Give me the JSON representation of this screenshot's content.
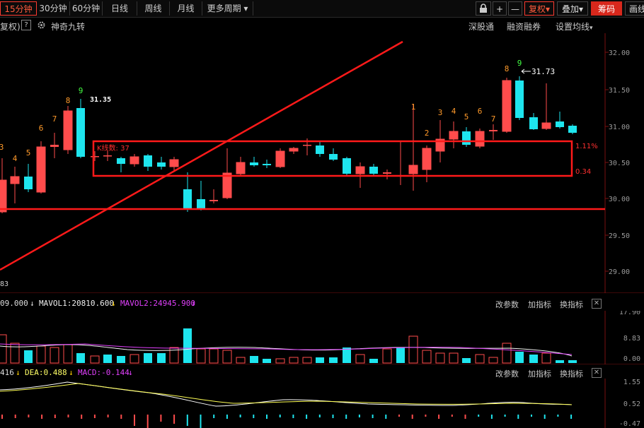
{
  "toolbar": {
    "tabs": [
      "15分钟",
      "30分钟",
      "60分钟",
      "日线",
      "周线",
      "月线",
      "更多周期"
    ],
    "active_tab": "15分钟",
    "more_arrow": "▾",
    "lock_icon": "lock-icon",
    "plus": "+",
    "minus": "—",
    "fuquan": "复权",
    "diejia": "叠加",
    "chouma": "筹码",
    "huaxian": "画线"
  },
  "subbar": {
    "fuquan": "复权)",
    "help": "?",
    "indicator": "神奇九转",
    "shengutong": "深股通",
    "rongzi": "融资融券",
    "settings": "设置均线"
  },
  "price_axis": [
    "32.00",
    "31.50",
    "31.00",
    "30.50",
    "30.00",
    "29.50",
    "29.00"
  ],
  "volume_axis": [
    "17.90",
    "8.83",
    "0.00"
  ],
  "macd_axis": [
    "1.55",
    "0.52",
    "-0.47"
  ],
  "annotations": {
    "high_left": "31.35",
    "high_right": "31.73",
    "box_count": "K线数: 37",
    "box_pct": "1.11%",
    "box_diff": "0.34",
    "bottom_left": "83"
  },
  "counts": {
    "left": [
      "3",
      "4",
      "5",
      "6",
      "7",
      "8",
      "9"
    ],
    "right": [
      "1",
      "2",
      "3",
      "4",
      "5",
      "6",
      "7",
      "8",
      "9"
    ]
  },
  "volume_row": {
    "vol": "09.000",
    "mavol1": "MAVOL1:20810.600",
    "mavol2": "MAVOL2:24945.900",
    "btn1": "改参数",
    "btn2": "加指标",
    "btn3": "换指标"
  },
  "macd_row": {
    "dif": "416",
    "dea": "DEA:0.488",
    "macd": "MACD:-0.144",
    "btn1": "改参数",
    "btn2": "加指标",
    "btn3": "换指标"
  },
  "colors": {
    "up": "#ff4c4c",
    "down": "#1ee5ee",
    "accent": "#ff2020",
    "mavol2": "#e040fb"
  }
}
